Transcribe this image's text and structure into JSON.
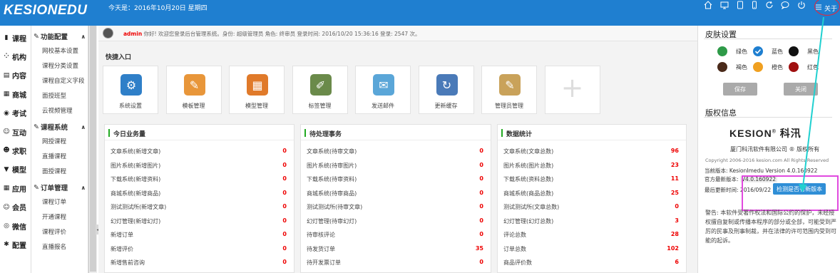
{
  "header": {
    "logo": "KESIONEDU",
    "date_text": "今天是：2016年10月20日 星期四",
    "icons": [
      "home-icon",
      "monitor-icon",
      "tablet-icon",
      "phone-icon",
      "refresh-icon",
      "chat-icon",
      "power-icon",
      "menu-icon"
    ],
    "about_label": "关于"
  },
  "left_nav": [
    {
      "icon": "book-icon",
      "glyph": "▮",
      "label": "课程"
    },
    {
      "icon": "org-icon",
      "glyph": "⁘",
      "label": "机构"
    },
    {
      "icon": "content-icon",
      "glyph": "▤",
      "label": "内容"
    },
    {
      "icon": "shop-icon",
      "glyph": "▦",
      "label": "商城"
    },
    {
      "icon": "exam-icon",
      "glyph": "◉",
      "label": "考试"
    },
    {
      "icon": "interact-icon",
      "glyph": "☺",
      "label": "互动"
    },
    {
      "icon": "job-icon",
      "glyph": "☻",
      "label": "求职"
    },
    {
      "icon": "model-icon",
      "glyph": "▼",
      "label": "模型"
    },
    {
      "icon": "apps-icon",
      "glyph": "▦",
      "label": "应用"
    },
    {
      "icon": "member-icon",
      "glyph": "☺",
      "label": "会员"
    },
    {
      "icon": "wechat-icon",
      "glyph": "◎",
      "label": "微信"
    },
    {
      "icon": "config-icon",
      "glyph": "✱",
      "label": "配置"
    }
  ],
  "sub_nav": {
    "groups": [
      {
        "title": "功能配置",
        "items": [
          "网校基本设置",
          "课程分类设置",
          "课程自定义字段",
          "面授班型",
          "云视频管理"
        ]
      },
      {
        "title": "课程系统",
        "items": [
          "网授课程",
          "直播课程",
          "面授课程"
        ]
      },
      {
        "title": "订单管理",
        "items": [
          "课程订单",
          "开通课程",
          "课程评价",
          "直播报名"
        ]
      }
    ],
    "last_partial": "..."
  },
  "welcome": {
    "user": "admin",
    "text": " 你好! 欢迎您登录后台管理系统。身份: 超级管理员 角色: 终审员 登录时间: 2016/10/20 15:36:16 登录: 2547 次。"
  },
  "quick": {
    "title": "快捷入口",
    "tiles": [
      {
        "label": "系统设置",
        "icon": "gear-icon",
        "glyph": "⚙",
        "color": "#2f7fc8"
      },
      {
        "label": "模板管理",
        "icon": "template-icon",
        "glyph": "✎",
        "color": "#e8963a"
      },
      {
        "label": "模型管理",
        "icon": "model-box-icon",
        "glyph": "▦",
        "color": "#e07a2a"
      },
      {
        "label": "标签管理",
        "icon": "tag-icon",
        "glyph": "✐",
        "color": "#6a8a4a"
      },
      {
        "label": "发送邮件",
        "icon": "mail-icon",
        "glyph": "✉",
        "color": "#5aa6d8"
      },
      {
        "label": "更新缓存",
        "icon": "cache-icon",
        "glyph": "↻",
        "color": "#4a7ab8"
      },
      {
        "label": "管理员管理",
        "icon": "admin-icon",
        "glyph": "✎",
        "color": "#c9a25a"
      }
    ]
  },
  "panels": [
    {
      "title": "今日业务量",
      "rows": [
        [
          "文章系统(新增文章)",
          "0"
        ],
        [
          "图片系统(新增图片)",
          "0"
        ],
        [
          "下载系统(新增资料)",
          "0"
        ],
        [
          "商城系统(新增商品)",
          "0"
        ],
        [
          "测试测试所(新增文章)",
          "0"
        ],
        [
          "幻灯管理(新增幻灯)",
          "0"
        ],
        [
          "新增订单",
          "0"
        ],
        [
          "新增评价",
          "0"
        ],
        [
          "新增售前咨询",
          "0"
        ]
      ]
    },
    {
      "title": "待处理事务",
      "rows": [
        [
          "文章系统(待审文章)",
          "0"
        ],
        [
          "图片系统(待审图片)",
          "0"
        ],
        [
          "下载系统(待审资料)",
          "0"
        ],
        [
          "商城系统(待审商品)",
          "0"
        ],
        [
          "测试测试所(待审文章)",
          "0"
        ],
        [
          "幻灯管理(待审幻灯)",
          "0"
        ],
        [
          "待审核评论",
          "0"
        ],
        [
          "待发货订单",
          "35"
        ],
        [
          "待开发票订单",
          "0"
        ]
      ]
    },
    {
      "title": "数据统计",
      "rows": [
        [
          "文章系统(文章总数)",
          "96"
        ],
        [
          "图片系统(图片总数)",
          "23"
        ],
        [
          "下载系统(资料总数)",
          "11"
        ],
        [
          "商城系统(商品总数)",
          "25"
        ],
        [
          "测试测试所(文章总数)",
          "0"
        ],
        [
          "幻灯管理(幻灯总数)",
          "3"
        ],
        [
          "评论总数",
          "28"
        ],
        [
          "订单总数",
          "102"
        ],
        [
          "商品评价数",
          "6"
        ]
      ]
    }
  ],
  "skin": {
    "title": "皮肤设置",
    "colors": [
      {
        "label": "绿色",
        "hex": "#2e9a48"
      },
      {
        "label": "蓝色",
        "hex": "#1f7fd0",
        "selected": true
      },
      {
        "label": "黑色",
        "hex": "#111111"
      },
      {
        "label": "褐色",
        "hex": "#4a2a1a"
      },
      {
        "label": "橙色",
        "hex": "#f0a020"
      },
      {
        "label": "红色",
        "hex": "#a01010"
      }
    ],
    "save_label": "保存",
    "close_label": "关闭"
  },
  "copyright": {
    "title": "版权信息",
    "logo_text": "KESION",
    "logo_suffix": "科汛",
    "company": "厦门科汛软件有限公司 ® 版权所有",
    "copy_text": "Copyright 2006-2016 kesion.com All Rights Reserved",
    "current_version": "当前版本: KesionImedu Version 4.0.160922",
    "latest_version_label": "官方最新版本:",
    "latest_version": "V4.0.160922",
    "last_update_label": "最后更新时间:",
    "last_update": "2016/09/22",
    "check_button": "检测是否有新版本",
    "warning": "警告: 本软件受著作权法和国际公约的保护，未经授权擅自复制或传播本程序的部分或全部，可能受到严厉的民事及刑事制裁，并在法律的许可范围内受到可能的起诉。"
  }
}
